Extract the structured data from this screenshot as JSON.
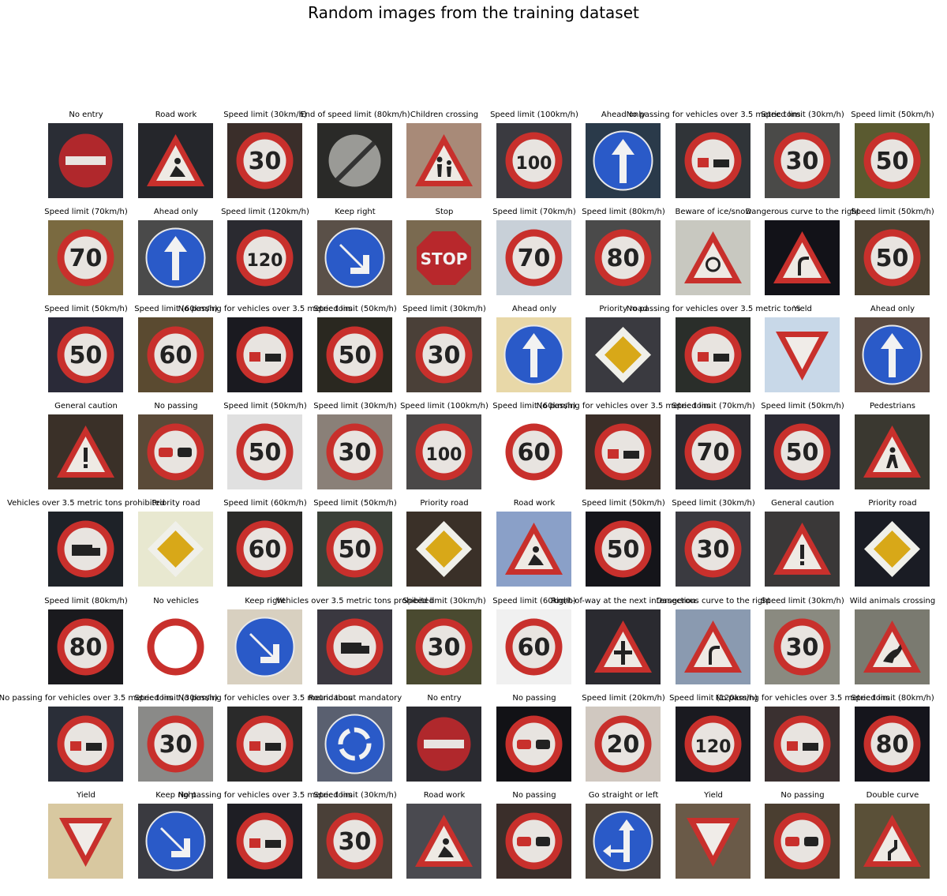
{
  "title": "Random images from the training dataset",
  "background_color": "#ffffff",
  "images": [
    {
      "label": "No entry",
      "icon": "no-entry-sign-icon",
      "bg": "#2a2d35"
    },
    {
      "label": "Road work",
      "icon": "road-work-sign-icon",
      "bg": "#25262b"
    },
    {
      "label": "Speed limit (30km/h)",
      "icon": "speed-limit-30-sign-icon",
      "bg": "#3a2e2a"
    },
    {
      "label": "End of speed limit (80km/h)",
      "icon": "end-speed-limit-80-sign-icon",
      "bg": "#2a2a28"
    },
    {
      "label": "Children crossing",
      "icon": "children-crossing-sign-icon",
      "bg": "#a88a78"
    },
    {
      "label": "Speed limit (100km/h)",
      "icon": "speed-limit-100-sign-icon",
      "bg": "#3a3a40"
    },
    {
      "label": "Ahead only",
      "icon": "ahead-only-sign-icon",
      "bg": "#2a3a4a"
    },
    {
      "label": "No passing for vehicles over 3.5 metric tons",
      "icon": "no-passing-trucks-sign-icon",
      "bg": "#303438"
    },
    {
      "label": "Speed limit (30km/h)",
      "icon": "speed-limit-30-sign-icon",
      "bg": "#4a4a48"
    },
    {
      "label": "Speed limit (50km/h)",
      "icon": "speed-limit-50-sign-icon",
      "bg": "#5a5a30"
    },
    {
      "label": "Speed limit (70km/h)",
      "icon": "speed-limit-70-sign-icon",
      "bg": "#7a6a40"
    },
    {
      "label": "Ahead only",
      "icon": "ahead-only-sign-icon",
      "bg": "#4a4a4a"
    },
    {
      "label": "Speed limit (120km/h)",
      "icon": "speed-limit-120-sign-icon",
      "bg": "#2a2a30"
    },
    {
      "label": "Keep right",
      "icon": "keep-right-sign-icon",
      "bg": "#5a5048"
    },
    {
      "label": "Stop",
      "icon": "stop-sign-icon",
      "bg": "#7a6a50"
    },
    {
      "label": "Speed limit (70km/h)",
      "icon": "speed-limit-70-sign-icon",
      "bg": "#c8d0d8"
    },
    {
      "label": "Speed limit (80km/h)",
      "icon": "speed-limit-80-sign-icon",
      "bg": "#4a4a4a"
    },
    {
      "label": "Beware of ice/snow",
      "icon": "ice-snow-sign-icon",
      "bg": "#c8c8c0"
    },
    {
      "label": "Dangerous curve to the right",
      "icon": "dangerous-curve-right-sign-icon",
      "bg": "#121218"
    },
    {
      "label": "Speed limit (50km/h)",
      "icon": "speed-limit-50-sign-icon",
      "bg": "#4a4030"
    },
    {
      "label": "Speed limit (50km/h)",
      "icon": "speed-limit-50-sign-icon",
      "bg": "#2a2a38"
    },
    {
      "label": "Speed limit (60km/h)",
      "icon": "speed-limit-60-sign-icon",
      "bg": "#5a4a30"
    },
    {
      "label": "No passing for vehicles over 3.5 metric tons",
      "icon": "no-passing-trucks-sign-icon",
      "bg": "#1a1a20"
    },
    {
      "label": "Speed limit (50km/h)",
      "icon": "speed-limit-50-sign-icon",
      "bg": "#2a2820"
    },
    {
      "label": "Speed limit (30km/h)",
      "icon": "speed-limit-30-sign-icon",
      "bg": "#4a4038"
    },
    {
      "label": "Ahead only",
      "icon": "ahead-only-sign-icon",
      "bg": "#e8d8a8"
    },
    {
      "label": "Priority road",
      "icon": "priority-road-sign-icon",
      "bg": "#3a3a40"
    },
    {
      "label": "No passing for vehicles over 3.5 metric tons",
      "icon": "no-passing-trucks-sign-icon",
      "bg": "#2a2e2a"
    },
    {
      "label": "Yield",
      "icon": "yield-sign-icon",
      "bg": "#c8d8e8"
    },
    {
      "label": "Ahead only",
      "icon": "ahead-only-sign-icon",
      "bg": "#5a4a40"
    },
    {
      "label": "General caution",
      "icon": "general-caution-sign-icon",
      "bg": "#3a3028"
    },
    {
      "label": "No passing",
      "icon": "no-passing-sign-icon",
      "bg": "#5a4a38"
    },
    {
      "label": "Speed limit (50km/h)",
      "icon": "speed-limit-50-sign-icon",
      "bg": "#e0e0e0"
    },
    {
      "label": "Speed limit (30km/h)",
      "icon": "speed-limit-30-sign-icon",
      "bg": "#8a8078"
    },
    {
      "label": "Speed limit (100km/h)",
      "icon": "speed-limit-100-sign-icon",
      "bg": "#4a4848"
    },
    {
      "label": "Speed limit (60km/h)",
      "icon": "speed-limit-60-sign-icon",
      "bg": "#ffffff"
    },
    {
      "label": "No passing for vehicles over 3.5 metric tons",
      "icon": "no-passing-trucks-sign-icon",
      "bg": "#3a2e28"
    },
    {
      "label": "Speed limit (70km/h)",
      "icon": "speed-limit-70-sign-icon",
      "bg": "#2a2a30"
    },
    {
      "label": "Speed limit (50km/h)",
      "icon": "speed-limit-50-sign-icon",
      "bg": "#2a2a34"
    },
    {
      "label": "Pedestrians",
      "icon": "pedestrians-sign-icon",
      "bg": "#3a3830"
    },
    {
      "label": "Vehicles over 3.5 metric tons prohibited",
      "icon": "trucks-prohibited-sign-icon",
      "bg": "#1e2228"
    },
    {
      "label": "Priority road",
      "icon": "priority-road-sign-icon",
      "bg": "#e8e8d0"
    },
    {
      "label": "Speed limit (60km/h)",
      "icon": "speed-limit-60-sign-icon",
      "bg": "#2a2a28"
    },
    {
      "label": "Speed limit (50km/h)",
      "icon": "speed-limit-50-sign-icon",
      "bg": "#3a4038"
    },
    {
      "label": "Priority road",
      "icon": "priority-road-sign-icon",
      "bg": "#3a3028"
    },
    {
      "label": "Road work",
      "icon": "road-work-sign-icon",
      "bg": "#8aa0c8"
    },
    {
      "label": "Speed limit (50km/h)",
      "icon": "speed-limit-50-sign-icon",
      "bg": "#15151a"
    },
    {
      "label": "Speed limit (30km/h)",
      "icon": "speed-limit-30-sign-icon",
      "bg": "#3a3a40"
    },
    {
      "label": "General caution",
      "icon": "general-caution-sign-icon",
      "bg": "#3a3838"
    },
    {
      "label": "Priority road",
      "icon": "priority-road-sign-icon",
      "bg": "#1a1c24"
    },
    {
      "label": "Speed limit (80km/h)",
      "icon": "speed-limit-80-sign-icon",
      "bg": "#1a1a1e"
    },
    {
      "label": "No vehicles",
      "icon": "no-vehicles-sign-icon",
      "bg": "#ffffff"
    },
    {
      "label": "Keep right",
      "icon": "keep-right-sign-icon",
      "bg": "#d8d0c0"
    },
    {
      "label": "Vehicles over 3.5 metric tons prohibited",
      "icon": "trucks-prohibited-sign-icon",
      "bg": "#3a3840"
    },
    {
      "label": "Speed limit (30km/h)",
      "icon": "speed-limit-30-sign-icon",
      "bg": "#4a4a30"
    },
    {
      "label": "Speed limit (60km/h)",
      "icon": "speed-limit-60-sign-icon",
      "bg": "#f0f0f0"
    },
    {
      "label": "Right-of-way at the next intersection",
      "icon": "right-of-way-sign-icon",
      "bg": "#2a2a30"
    },
    {
      "label": "Dangerous curve to the right",
      "icon": "dangerous-curve-right-sign-icon",
      "bg": "#8a9ab0"
    },
    {
      "label": "Speed limit (30km/h)",
      "icon": "speed-limit-30-sign-icon",
      "bg": "#8a8a80"
    },
    {
      "label": "Wild animals crossing",
      "icon": "wild-animals-sign-icon",
      "bg": "#7a7a70"
    },
    {
      "label": "No passing for vehicles over 3.5 metric tons",
      "icon": "no-passing-trucks-sign-icon",
      "bg": "#2a2e38"
    },
    {
      "label": "Speed limit (30km/h)",
      "icon": "speed-limit-30-sign-icon",
      "bg": "#8a8a88"
    },
    {
      "label": "No passing for vehicles over 3.5 metric tons",
      "icon": "no-passing-trucks-sign-icon",
      "bg": "#2a2a2a"
    },
    {
      "label": "Roundabout mandatory",
      "icon": "roundabout-sign-icon",
      "bg": "#5a6070"
    },
    {
      "label": "No entry",
      "icon": "no-entry-sign-icon",
      "bg": "#2a2a30"
    },
    {
      "label": "No passing",
      "icon": "no-passing-sign-icon",
      "bg": "#121216"
    },
    {
      "label": "Speed limit (20km/h)",
      "icon": "speed-limit-20-sign-icon",
      "bg": "#d0c8c0"
    },
    {
      "label": "Speed limit (120km/h)",
      "icon": "speed-limit-120-sign-icon",
      "bg": "#1a1a20"
    },
    {
      "label": "No passing for vehicles over 3.5 metric tons",
      "icon": "no-passing-trucks-sign-icon",
      "bg": "#3a3030"
    },
    {
      "label": "Speed limit (80km/h)",
      "icon": "speed-limit-80-sign-icon",
      "bg": "#15151c"
    },
    {
      "label": "Yield",
      "icon": "yield-sign-icon",
      "bg": "#d8c8a0"
    },
    {
      "label": "Keep right",
      "icon": "keep-right-sign-icon",
      "bg": "#3a3a40"
    },
    {
      "label": "No passing for vehicles over 3.5 metric tons",
      "icon": "no-passing-trucks-sign-icon",
      "bg": "#1e1e24"
    },
    {
      "label": "Speed limit (30km/h)",
      "icon": "speed-limit-30-sign-icon",
      "bg": "#4a4038"
    },
    {
      "label": "Road work",
      "icon": "road-work-sign-icon",
      "bg": "#4a4a50"
    },
    {
      "label": "No passing",
      "icon": "no-passing-sign-icon",
      "bg": "#3a2e2a"
    },
    {
      "label": "Go straight or left",
      "icon": "go-straight-or-left-sign-icon",
      "bg": "#4a4038"
    },
    {
      "label": "Yield",
      "icon": "yield-sign-icon",
      "bg": "#6a5a48"
    },
    {
      "label": "No passing",
      "icon": "no-passing-sign-icon",
      "bg": "#4a3e30"
    },
    {
      "label": "Double curve",
      "icon": "double-curve-sign-icon",
      "bg": "#5a5038"
    }
  ]
}
